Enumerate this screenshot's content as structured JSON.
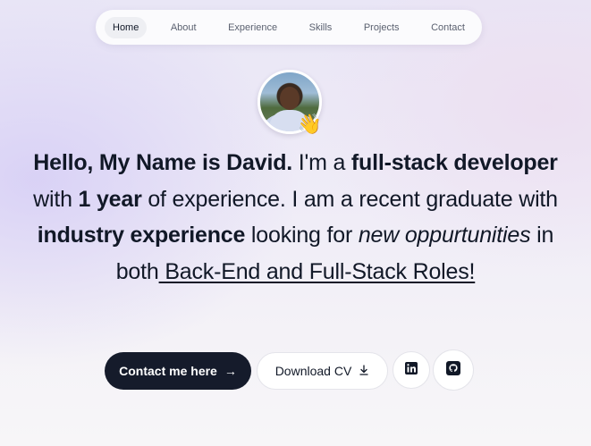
{
  "nav": {
    "items": [
      {
        "label": "Home"
      },
      {
        "label": "About"
      },
      {
        "label": "Experience"
      },
      {
        "label": "Skills"
      },
      {
        "label": "Projects"
      },
      {
        "label": "Contact"
      }
    ]
  },
  "hero": {
    "avatar_icon": "profile-photo",
    "wave_icon": "waving-hand-icon",
    "headline": {
      "p1": "Hello, My Name is David.",
      "p2": " I'm a ",
      "p3": "full-stack developer",
      "p4": " with ",
      "p5": "1 year",
      "p6": " of experience. I am a recent graduate with ",
      "p7": "industry experience",
      "p8": " looking for ",
      "p9": "new oppurtunities",
      "p10": " in both",
      "p11": " Back-End and Full-Stack Roles!"
    }
  },
  "actions": {
    "contact_label": "Contact me here",
    "contact_icon": "arrow-right-icon",
    "download_label": "Download CV",
    "download_icon": "download-icon",
    "linkedin_icon": "linkedin-icon",
    "github_icon": "github-icon"
  }
}
